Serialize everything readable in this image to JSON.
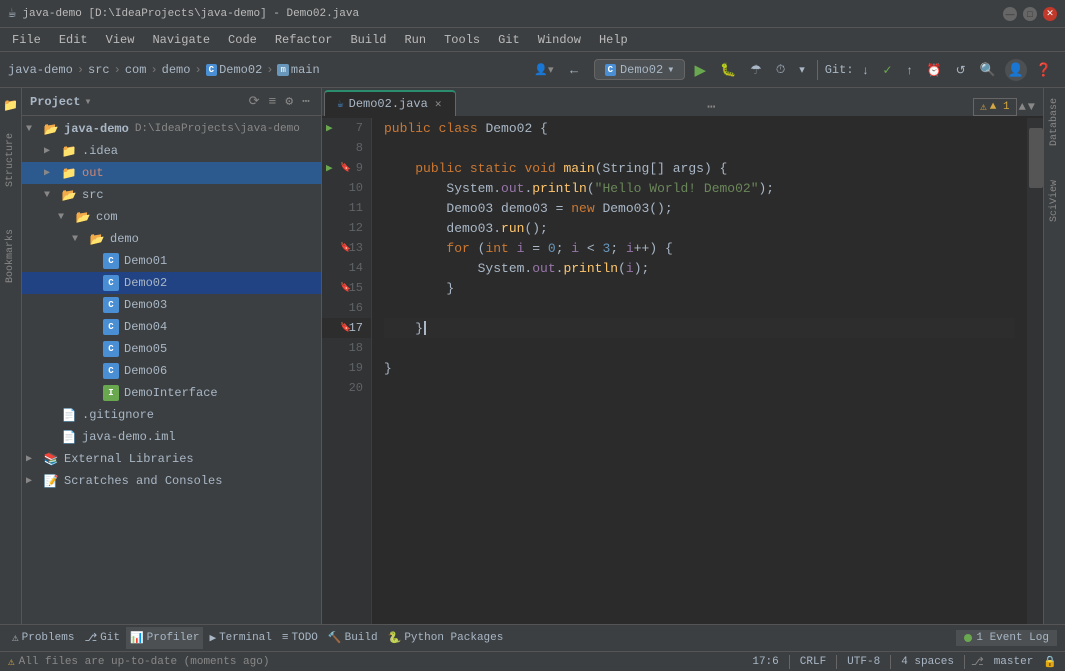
{
  "title_bar": {
    "title": "java-demo [D:\\IdeaProjects\\java-demo] - Demo02.java",
    "app_icon": "☕"
  },
  "menu": {
    "items": [
      "File",
      "Edit",
      "View",
      "Navigate",
      "Code",
      "Refactor",
      "Build",
      "Run",
      "Tools",
      "Git",
      "Window",
      "Help"
    ]
  },
  "toolbar": {
    "breadcrumb": {
      "parts": [
        "java-demo",
        "src",
        "com",
        "demo",
        "Demo02",
        "main"
      ]
    },
    "run_config": "Demo02",
    "git_label": "Git:",
    "search_icon": "🔍",
    "settings_icon": "⚙"
  },
  "project_panel": {
    "title": "Project",
    "root": "java-demo",
    "root_path": "D:\\IdeaProjects\\java-demo",
    "items": [
      {
        "label": ".idea",
        "type": "folder",
        "depth": 1,
        "collapsed": true
      },
      {
        "label": "out",
        "type": "folder-orange",
        "depth": 1,
        "collapsed": true
      },
      {
        "label": "src",
        "type": "folder",
        "depth": 1,
        "collapsed": false
      },
      {
        "label": "com",
        "type": "folder",
        "depth": 2,
        "collapsed": false
      },
      {
        "label": "demo",
        "type": "folder",
        "depth": 3,
        "collapsed": false
      },
      {
        "label": "Demo01",
        "type": "class",
        "depth": 4
      },
      {
        "label": "Demo02",
        "type": "class",
        "depth": 4,
        "selected": true
      },
      {
        "label": "Demo03",
        "type": "class",
        "depth": 4
      },
      {
        "label": "Demo04",
        "type": "class",
        "depth": 4
      },
      {
        "label": "Demo05",
        "type": "class",
        "depth": 4
      },
      {
        "label": "Demo06",
        "type": "class",
        "depth": 4
      },
      {
        "label": "DemoInterface",
        "type": "interface",
        "depth": 4
      },
      {
        "label": ".gitignore",
        "type": "file",
        "depth": 1
      },
      {
        "label": "java-demo.iml",
        "type": "file",
        "depth": 1
      },
      {
        "label": "External Libraries",
        "type": "library",
        "depth": 0
      },
      {
        "label": "Scratches and Consoles",
        "type": "scratches",
        "depth": 0
      }
    ]
  },
  "editor": {
    "tab_filename": "Demo02.java",
    "tab_icon": "☕",
    "lines": [
      {
        "num": 7,
        "content": "public class Demo02 {",
        "tokens": [
          {
            "t": "kw",
            "v": "public"
          },
          {
            "t": "plain",
            "v": " "
          },
          {
            "t": "kw",
            "v": "class"
          },
          {
            "t": "plain",
            "v": " Demo02 {"
          }
        ]
      },
      {
        "num": 8,
        "content": "",
        "tokens": []
      },
      {
        "num": 9,
        "content": "    public static void main(String[] args) {",
        "has_arrow": true,
        "has_bookmark": true,
        "tokens": [
          {
            "t": "plain",
            "v": "    "
          },
          {
            "t": "kw",
            "v": "public"
          },
          {
            "t": "plain",
            "v": " "
          },
          {
            "t": "kw",
            "v": "static"
          },
          {
            "t": "plain",
            "v": " "
          },
          {
            "t": "kw",
            "v": "void"
          },
          {
            "t": "plain",
            "v": " "
          },
          {
            "t": "fn",
            "v": "main"
          },
          {
            "t": "plain",
            "v": "("
          },
          {
            "t": "type",
            "v": "String"
          },
          {
            "t": "plain",
            "v": "[] "
          },
          {
            "t": "plain",
            "v": "args) {"
          }
        ]
      },
      {
        "num": 10,
        "content": "        System.out.println(\"Hello World! Demo02\");",
        "tokens": [
          {
            "t": "plain",
            "v": "        System."
          },
          {
            "t": "field",
            "v": "out"
          },
          {
            "t": "plain",
            "v": "."
          },
          {
            "t": "fn",
            "v": "println"
          },
          {
            "t": "plain",
            "v": "("
          },
          {
            "t": "str",
            "v": "\"Hello World! Demo02\""
          },
          {
            "t": "plain",
            "v": ");"
          }
        ]
      },
      {
        "num": 11,
        "content": "        Demo03 demo03 = new Demo03();",
        "tokens": [
          {
            "t": "plain",
            "v": "        Demo03 demo03 = "
          },
          {
            "t": "kw",
            "v": "new"
          },
          {
            "t": "plain",
            "v": " Demo03();"
          }
        ]
      },
      {
        "num": 12,
        "content": "        demo03.run();",
        "tokens": [
          {
            "t": "plain",
            "v": "        demo03."
          },
          {
            "t": "fn",
            "v": "run"
          },
          {
            "t": "plain",
            "v": "();"
          }
        ]
      },
      {
        "num": 13,
        "content": "        for (int i = 0; i < 3; i++) {",
        "has_bookmark": true,
        "tokens": [
          {
            "t": "plain",
            "v": "        "
          },
          {
            "t": "kw",
            "v": "for"
          },
          {
            "t": "plain",
            "v": " ("
          },
          {
            "t": "kw",
            "v": "int"
          },
          {
            "t": "plain",
            "v": " "
          },
          {
            "t": "var",
            "v": "i"
          },
          {
            "t": "plain",
            "v": " = "
          },
          {
            "t": "num",
            "v": "0"
          },
          {
            "t": "plain",
            "v": "; "
          },
          {
            "t": "var",
            "v": "i"
          },
          {
            "t": "plain",
            "v": " < "
          },
          {
            "t": "num",
            "v": "3"
          },
          {
            "t": "plain",
            "v": "; "
          },
          {
            "t": "var",
            "v": "i"
          },
          {
            "t": "plain",
            "v": "++) {"
          }
        ]
      },
      {
        "num": 14,
        "content": "            System.out.println(i);",
        "tokens": [
          {
            "t": "plain",
            "v": "            System."
          },
          {
            "t": "field",
            "v": "out"
          },
          {
            "t": "plain",
            "v": "."
          },
          {
            "t": "fn",
            "v": "println"
          },
          {
            "t": "plain",
            "v": "("
          },
          {
            "t": "var",
            "v": "i"
          },
          {
            "t": "plain",
            "v": ");"
          }
        ]
      },
      {
        "num": 15,
        "content": "        }",
        "has_bookmark": true,
        "tokens": [
          {
            "t": "plain",
            "v": "        }"
          }
        ]
      },
      {
        "num": 16,
        "content": "",
        "tokens": []
      },
      {
        "num": 17,
        "content": "    }",
        "has_bookmark": true,
        "cursor": true,
        "tokens": [
          {
            "t": "plain",
            "v": "    }"
          },
          {
            "t": "plain",
            "v": "▌"
          }
        ]
      },
      {
        "num": 18,
        "content": "",
        "tokens": []
      },
      {
        "num": 19,
        "content": "}",
        "tokens": [
          {
            "t": "plain",
            "v": "}"
          }
        ]
      },
      {
        "num": 20,
        "content": "",
        "tokens": []
      }
    ],
    "notification": "▲ 1",
    "cursor_position": "17:6",
    "line_separator": "CRLF",
    "encoding": "UTF-8",
    "indent": "4 spaces"
  },
  "status_bar": {
    "message": "All files are up-to-date (moments ago)",
    "position": "17:6",
    "line_separator": "CRLF",
    "encoding": "UTF-8",
    "indent": "4 spaces",
    "git_branch": "master",
    "event_log_dot_color": "#6aa84f",
    "event_log_label": "1 Event Log"
  },
  "bottom_tabs": [
    {
      "label": "Problems",
      "icon": "⚠"
    },
    {
      "label": "Git",
      "icon": "⎇"
    },
    {
      "label": "Profiler",
      "icon": "📊"
    },
    {
      "label": "Terminal",
      "icon": "▶"
    },
    {
      "label": "TODO",
      "icon": "≡"
    },
    {
      "label": "Build",
      "icon": "🔨"
    },
    {
      "label": "Python Packages",
      "icon": "🐍"
    }
  ],
  "right_panels": [
    "Database",
    "SciView"
  ],
  "colors": {
    "accent": "#2b8c6e",
    "selection": "#214283",
    "background": "#2b2b2b",
    "panel": "#3c3f41"
  }
}
